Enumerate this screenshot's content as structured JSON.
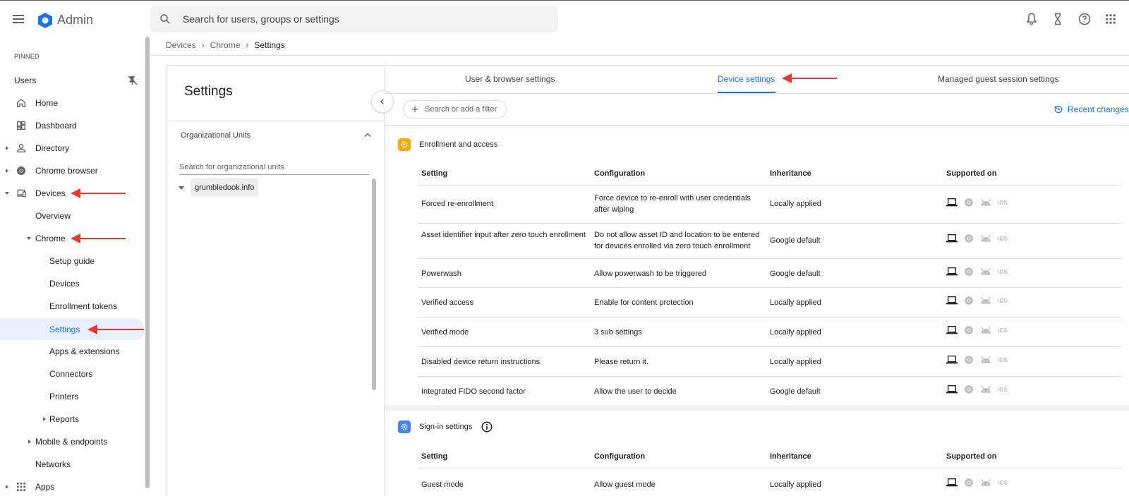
{
  "header": {
    "app_title": "Admin",
    "search_placeholder": "Search for users, groups or settings"
  },
  "sidebar": {
    "pinned_label": "PINNED",
    "items": [
      {
        "label": "Users"
      },
      {
        "label": "Home"
      },
      {
        "label": "Dashboard"
      },
      {
        "label": "Directory"
      },
      {
        "label": "Chrome browser"
      },
      {
        "label": "Devices"
      },
      {
        "label": "Overview"
      },
      {
        "label": "Chrome"
      },
      {
        "label": "Setup guide"
      },
      {
        "label": "Devices"
      },
      {
        "label": "Enrollment tokens"
      },
      {
        "label": "Settings"
      },
      {
        "label": "Apps & extensions"
      },
      {
        "label": "Connectors"
      },
      {
        "label": "Printers"
      },
      {
        "label": "Reports"
      },
      {
        "label": "Mobile & endpoints"
      },
      {
        "label": "Networks"
      },
      {
        "label": "Apps"
      }
    ]
  },
  "breadcrumb": [
    "Devices",
    "Chrome",
    "Settings"
  ],
  "ou_panel": {
    "title": "Settings",
    "section_label": "Organizational Units",
    "search_placeholder": "Search for organizational units",
    "root_node": "grumbledook.info"
  },
  "tabs": [
    {
      "label": "User & browser settings"
    },
    {
      "label": "Device settings"
    },
    {
      "label": "Managed guest session settings"
    }
  ],
  "filter_placeholder": "Search or add a filter",
  "recent_changes": "Recent changes",
  "columns": [
    "Setting",
    "Configuration",
    "Inheritance",
    "Supported on"
  ],
  "sections": [
    {
      "title": "Enrollment and access",
      "rows": [
        {
          "setting": "Forced re-enrollment",
          "configuration": "Force device to re-enroll with user credentials after wiping",
          "inheritance": "Locally applied"
        },
        {
          "setting": "Asset identifier input after zero touch enrollment",
          "configuration": "Do not allow asset ID and location to be entered for devices enrolled via zero touch enrollment",
          "inheritance": "Google default"
        },
        {
          "setting": "Powerwash",
          "configuration": "Allow powerwash to be triggered",
          "inheritance": "Google default"
        },
        {
          "setting": "Verified access",
          "configuration": "Enable for content protection",
          "inheritance": "Locally applied"
        },
        {
          "setting": "Verified mode",
          "configuration": "3 sub settings",
          "inheritance": "Locally applied"
        },
        {
          "setting": "Disabled device return instructions",
          "configuration": "Please return it.",
          "inheritance": "Locally applied"
        },
        {
          "setting": "Integrated FIDO second factor",
          "configuration": "Allow the user to decide",
          "inheritance": "Google default"
        }
      ]
    },
    {
      "title": "Sign-in settings",
      "rows": [
        {
          "setting": "Guest mode",
          "configuration": "Allow guest mode",
          "inheritance": "Locally applied"
        }
      ]
    }
  ],
  "ios_label": "iOS",
  "colors": {
    "accent": "#1a73e8",
    "annotation_arrow": "#e53935",
    "enrollment_icon": "#f9ab00",
    "signin_icon": "#4285f4"
  }
}
